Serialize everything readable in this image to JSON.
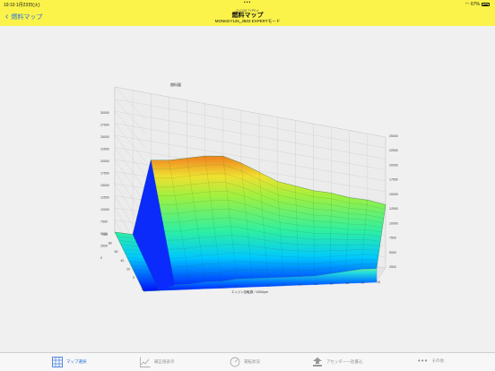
{
  "status": {
    "time": "19:10",
    "date": "1月23日(火)",
    "battery": "67%"
  },
  "nav": {
    "back_label": "燃料マップ",
    "subtitle": "FI CON TYPE-e",
    "title": "燃料マップ",
    "model": "MONKEY125_JB03 EXPERTモード"
  },
  "chart_data": {
    "type": "surface3d",
    "title": "燃料量",
    "xlabel": "エンジン回転数 / 1000rpm",
    "x_ticks": [
      "0",
      "1",
      "2",
      "3",
      "4",
      "5",
      "6",
      "7",
      "8",
      "9",
      "10",
      "11",
      "12",
      "13",
      "14",
      "15"
    ],
    "y_ticks": [
      "0",
      "20",
      "40",
      "60",
      "80",
      "100"
    ],
    "z_ticks_left": [
      "0",
      "2500",
      "5000",
      "7500",
      "10000",
      "12500",
      "15000",
      "17500",
      "20000",
      "22500",
      "25000",
      "27500",
      "30000"
    ],
    "z_ticks_right": [
      "2500",
      "5000",
      "7500",
      "10000",
      "12500",
      "15000",
      "17500",
      "20000",
      "22500",
      "25000"
    ],
    "zlim": [
      0,
      30000
    ],
    "grid": true,
    "surface_profile_at_max_throttle": [
      0,
      0,
      17000,
      17500,
      18500,
      19500,
      20000,
      19000,
      17500,
      16000,
      15500,
      15000,
      15000,
      14500,
      14500,
      14000
    ],
    "surface_profile_at_zero_throttle": [
      0,
      0,
      1500,
      1500,
      2000,
      2000,
      2500,
      2500,
      2500,
      2500,
      2500,
      2500,
      3000,
      3500,
      4000,
      4000
    ]
  },
  "tabs": [
    {
      "label": "マップ選択",
      "icon": "grid-icon",
      "active": true
    },
    {
      "label": "補正値表示",
      "icon": "graph-icon",
      "active": false
    },
    {
      "label": "運転状況",
      "icon": "gauge-icon",
      "active": false
    },
    {
      "label": "アセッター一括書込",
      "icon": "upload-icon",
      "active": false
    },
    {
      "label": "その他",
      "icon": "more-icon",
      "active": false
    }
  ],
  "colors": {
    "accent": "#2a6fdc",
    "bar": "#fbf34a"
  }
}
